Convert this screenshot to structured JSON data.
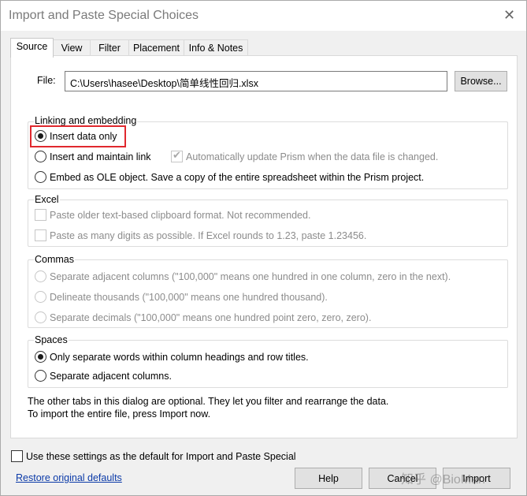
{
  "window": {
    "title": "Import and Paste Special Choices"
  },
  "tabs": [
    "Source",
    "View",
    "Filter",
    "Placement",
    "Info & Notes"
  ],
  "file": {
    "label": "File:",
    "value": "C:\\Users\\hasee\\Desktop\\简单线性回归.xlsx",
    "browse_label": "Browse..."
  },
  "linking": {
    "title": "Linking and embedding",
    "insert_only": "Insert data only",
    "insert_maintain": "Insert and maintain link",
    "auto_update": "Automatically update Prism when the data file is changed.",
    "embed_ole": "Embed as OLE object. Save a copy of the entire spreadsheet within the Prism project."
  },
  "excel": {
    "title": "Excel",
    "paste_older": "Paste older text-based clipboard format. Not recommended.",
    "paste_digits": "Paste as many digits as possible. If Excel rounds to 1.23, paste 1.23456."
  },
  "commas": {
    "title": "Commas",
    "separate_columns": "Separate adjacent columns (\"100,000\" means one hundred in one column, zero in the next).",
    "delineate_thousands": "Delineate thousands (\"100,000\" means one hundred thousand).",
    "separate_decimals": "Separate decimals (\"100,000\" means one hundred point zero, zero, zero)."
  },
  "spaces": {
    "title": "Spaces",
    "only_separate_words": "Only separate words within column headings and row titles.",
    "separate_adjacent": "Separate adjacent columns."
  },
  "notes": {
    "line1": "The other tabs in this dialog are optional. They let you filter and rearrange the data.",
    "line2": "To import the entire file, press Import now."
  },
  "footer": {
    "default_checkbox": "Use these settings as the default for Import and Paste Special",
    "restore_link": "Restore original defaults",
    "help": "Help",
    "cancel": "Cancel",
    "import": "Import"
  },
  "watermark": "知乎 @BioMan"
}
